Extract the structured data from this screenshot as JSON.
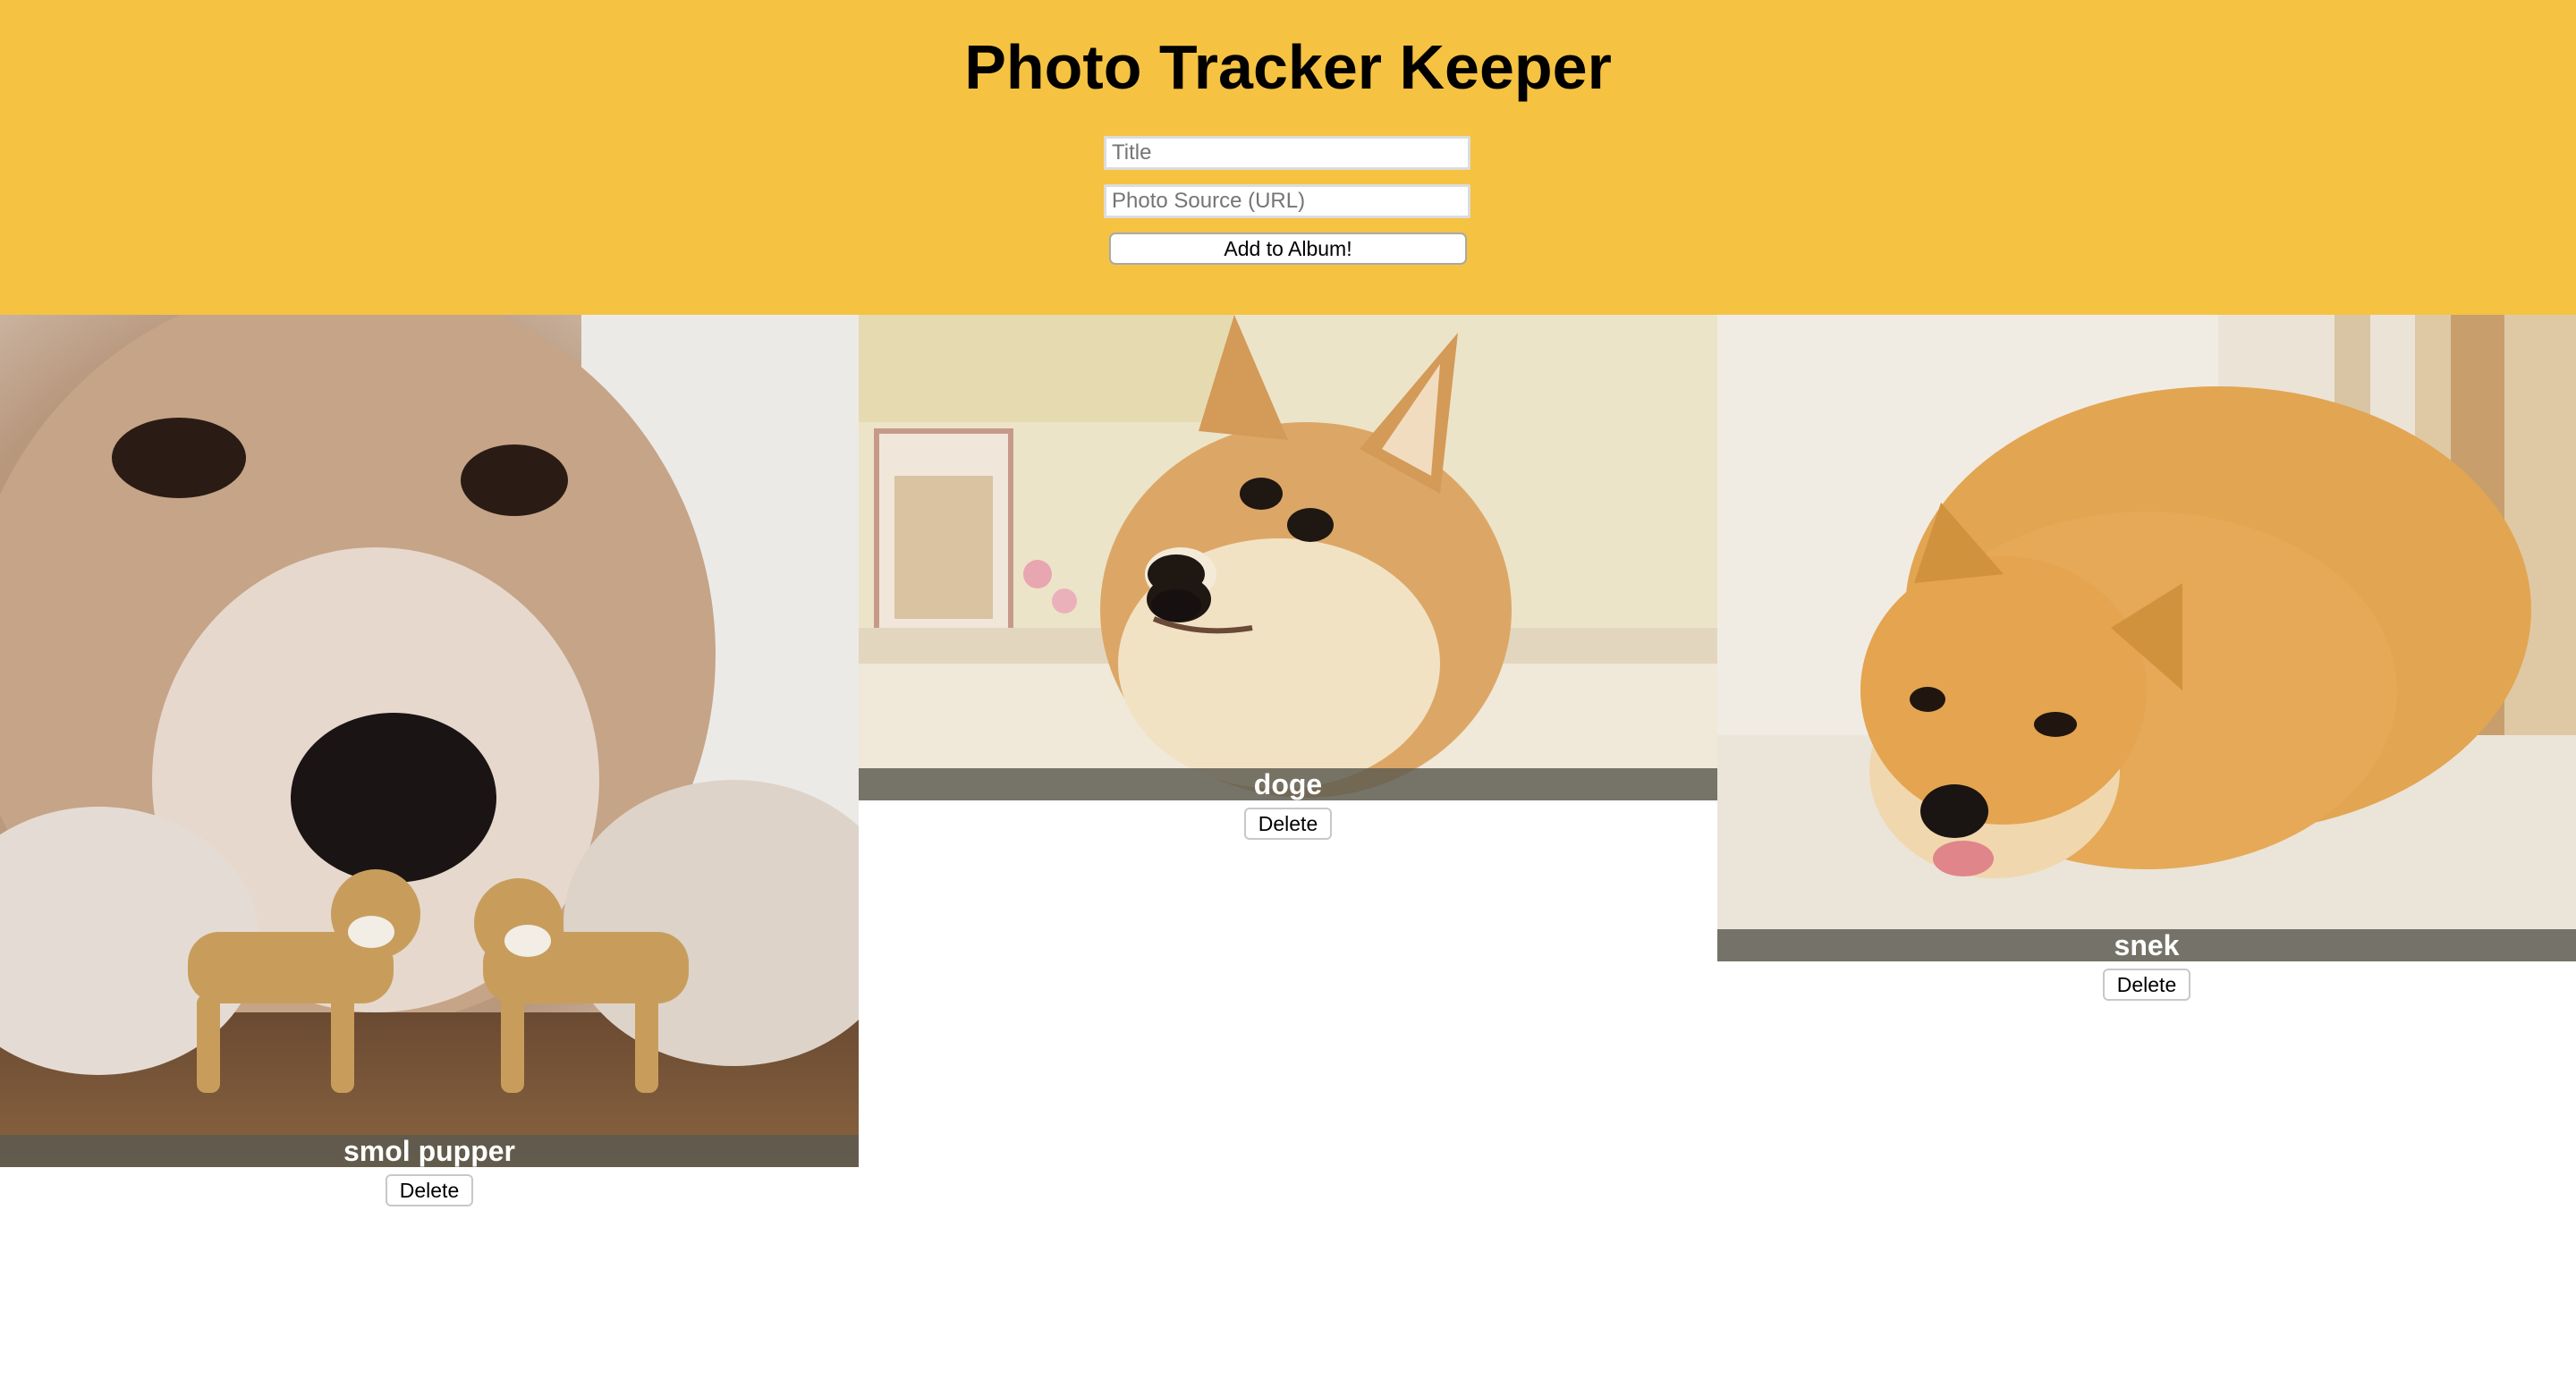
{
  "header": {
    "title": "Photo Tracker Keeper",
    "title_placeholder": "Title",
    "source_placeholder": "Photo Source (URL)",
    "add_label": "Add to Album!"
  },
  "photos": [
    {
      "title": "smol pupper",
      "delete_label": "Delete",
      "picture": "shiba-closeup-with-toy-figures"
    },
    {
      "title": "doge",
      "delete_label": "Delete",
      "picture": "doge-shiba-sideways-glance"
    },
    {
      "title": "snek",
      "delete_label": "Delete",
      "picture": "shiba-lying-on-floor"
    }
  ],
  "colors": {
    "header_background": "#f5c242",
    "caption_bar": "#5a5a50"
  }
}
